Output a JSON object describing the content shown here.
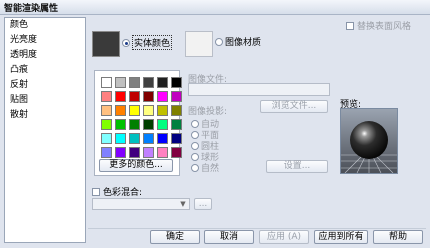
{
  "window": {
    "title": "智能渲染属性"
  },
  "nav": {
    "items": [
      "颜色",
      "光亮度",
      "透明度",
      "凸痕",
      "反射",
      "贴图",
      "散射"
    ]
  },
  "replace_style": {
    "label": "替换表面风格",
    "checked": false
  },
  "mode": {
    "solid_color": "实体颜色",
    "image_material": "图像材质",
    "selected": "solid_color"
  },
  "solid_color_value": "#3a3a3a",
  "palette": {
    "colors": [
      "#ffffff",
      "#c0c0c0",
      "#808080",
      "#404040",
      "#202020",
      "#000000",
      "#ff8080",
      "#ff0000",
      "#c00000",
      "#800000",
      "#ff00ff",
      "#c000c0",
      "#ffc080",
      "#ff8000",
      "#ffff00",
      "#ffff80",
      "#c0c000",
      "#808000",
      "#80ff00",
      "#00c000",
      "#008000",
      "#004000",
      "#00ff80",
      "#008040",
      "#80ffff",
      "#00ffff",
      "#00c0c0",
      "#0080ff",
      "#0000ff",
      "#000080",
      "#8080ff",
      "#8000ff",
      "#400080",
      "#c080ff",
      "#ff80c0",
      "#800040"
    ],
    "more_colors_button": "更多的颜色..."
  },
  "image_file": {
    "label": "图像文件:",
    "value": "",
    "browse_button": "浏览文件..."
  },
  "image_projection": {
    "label": "图像投影:",
    "options": [
      "自动",
      "平面",
      "圆柱",
      "球形",
      "自然"
    ],
    "settings_button": "设置..."
  },
  "preview": {
    "label": "预览:"
  },
  "color_mix": {
    "label": "色彩混合:",
    "checked": false,
    "selected": "",
    "more_button": "..."
  },
  "footer": {
    "ok": "确定",
    "cancel": "取消",
    "apply": "应用 (A)",
    "apply_all": "应用到所有",
    "help": "帮助"
  }
}
